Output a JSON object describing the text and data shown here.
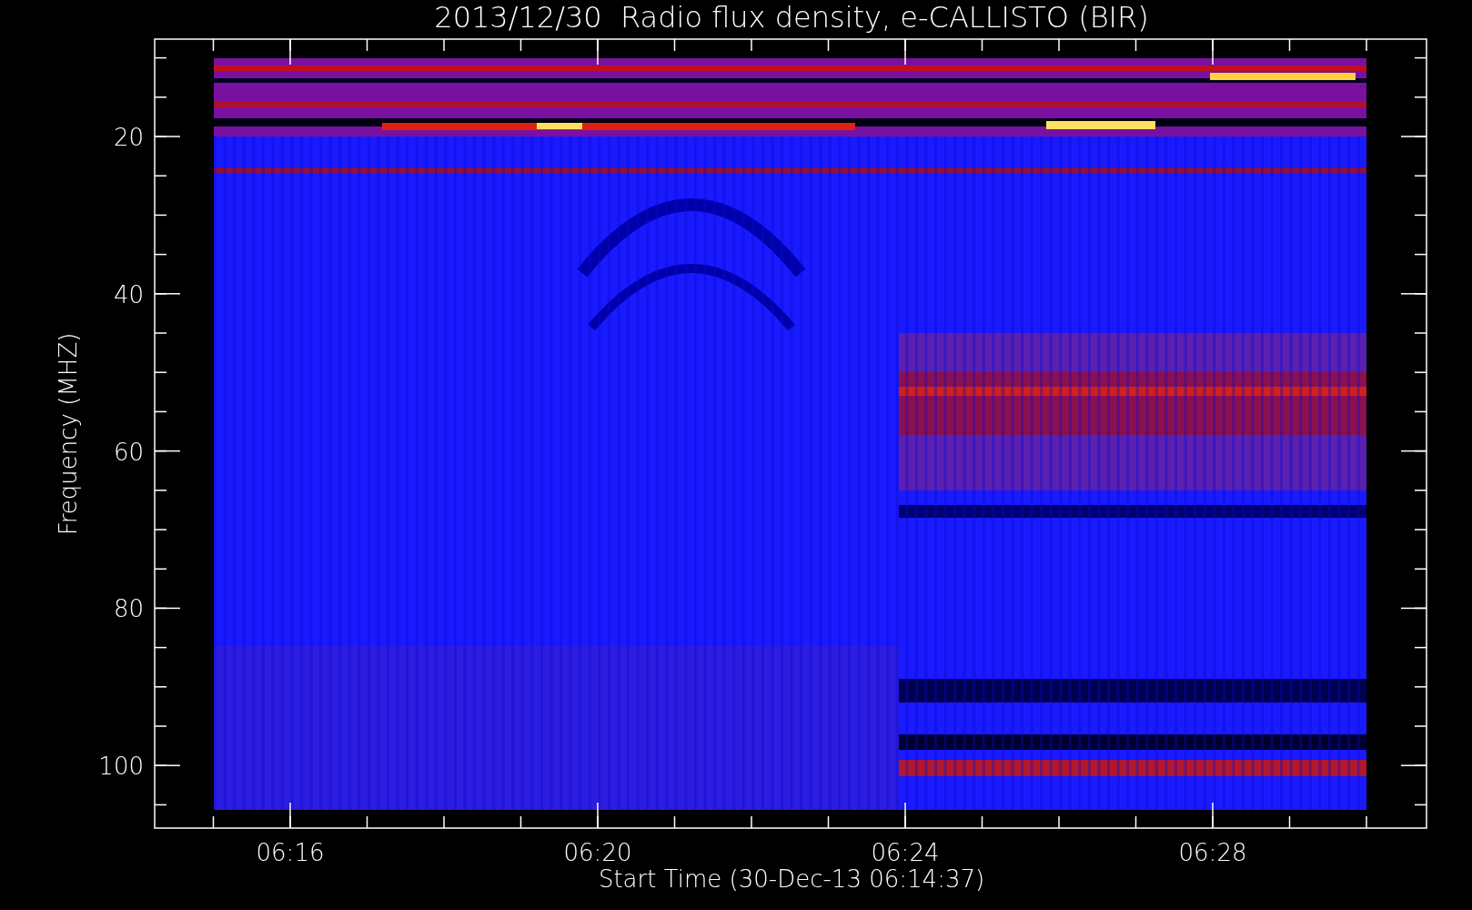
{
  "title": "2013/12/30  Radio flux density, e-CALLISTO (BIR)",
  "xlabel": "Start Time (30-Dec-13 06:14:37)",
  "ylabel": "Frequency (MHZ)",
  "xticks": [
    {
      "label": "06:16"
    },
    {
      "label": "06:20"
    },
    {
      "label": "06:24"
    },
    {
      "label": "06:28"
    }
  ],
  "yticks": [
    {
      "label": "20"
    },
    {
      "label": "40"
    },
    {
      "label": "60"
    },
    {
      "label": "80"
    },
    {
      "label": "100"
    }
  ]
}
